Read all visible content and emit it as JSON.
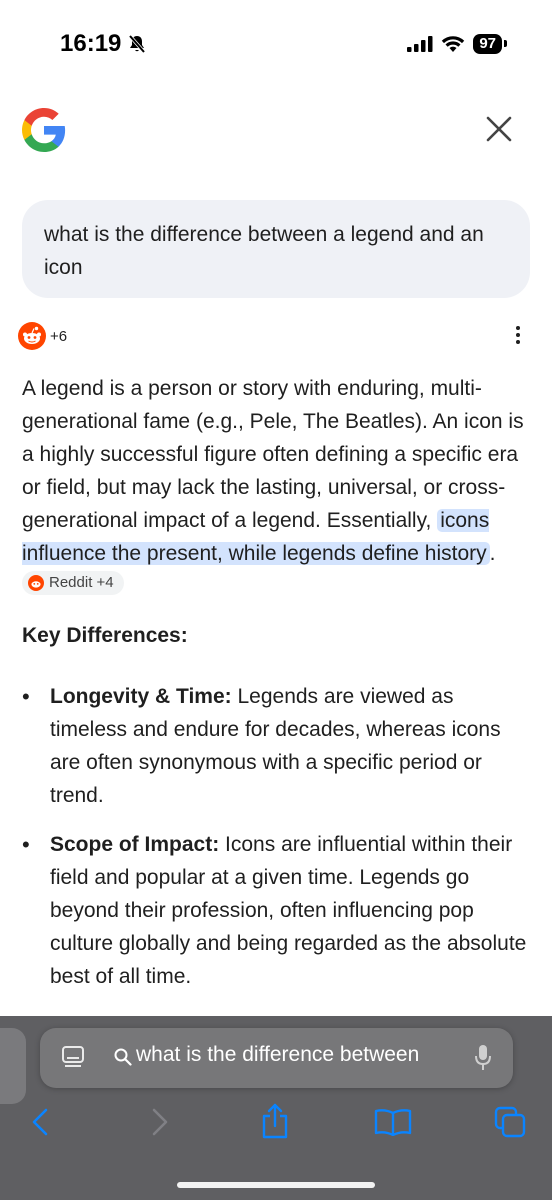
{
  "status": {
    "time": "16:19",
    "battery": "97"
  },
  "query": "what is the difference between a legend and an icon",
  "sources": {
    "extra_count": "+6"
  },
  "answer": {
    "part1": "A legend is a person or story with enduring, multi-generational fame (e.g., Pele, The Beatles). An icon is a highly successful figure often defining a specific era or field, but may lack the lasting, universal, or cross-generational impact of a legend. Essentially, ",
    "highlight": "icons influence the present, while legends define history",
    "after_highlight": ".",
    "chip_label": "Reddit +4"
  },
  "key_differences": {
    "title": "Key Differences:",
    "items": [
      {
        "term": "Longevity & Time:",
        "text": " Legends are viewed as timeless and endure for decades, whereas icons are often synonymous with a specific period or trend."
      },
      {
        "term": "Scope of Impact:",
        "text": " Icons are influential within their field and popular at a given time. Legends go beyond their profession, often influencing pop culture globally and being regarded as the absolute best of all time."
      }
    ]
  },
  "browser": {
    "url_text": "what is the difference between"
  },
  "colors": {
    "highlight": "#d3e3fd",
    "query_bubble": "#eff1f6",
    "toolbar_icon": "#0a84ff",
    "reddit": "#ff4500"
  }
}
